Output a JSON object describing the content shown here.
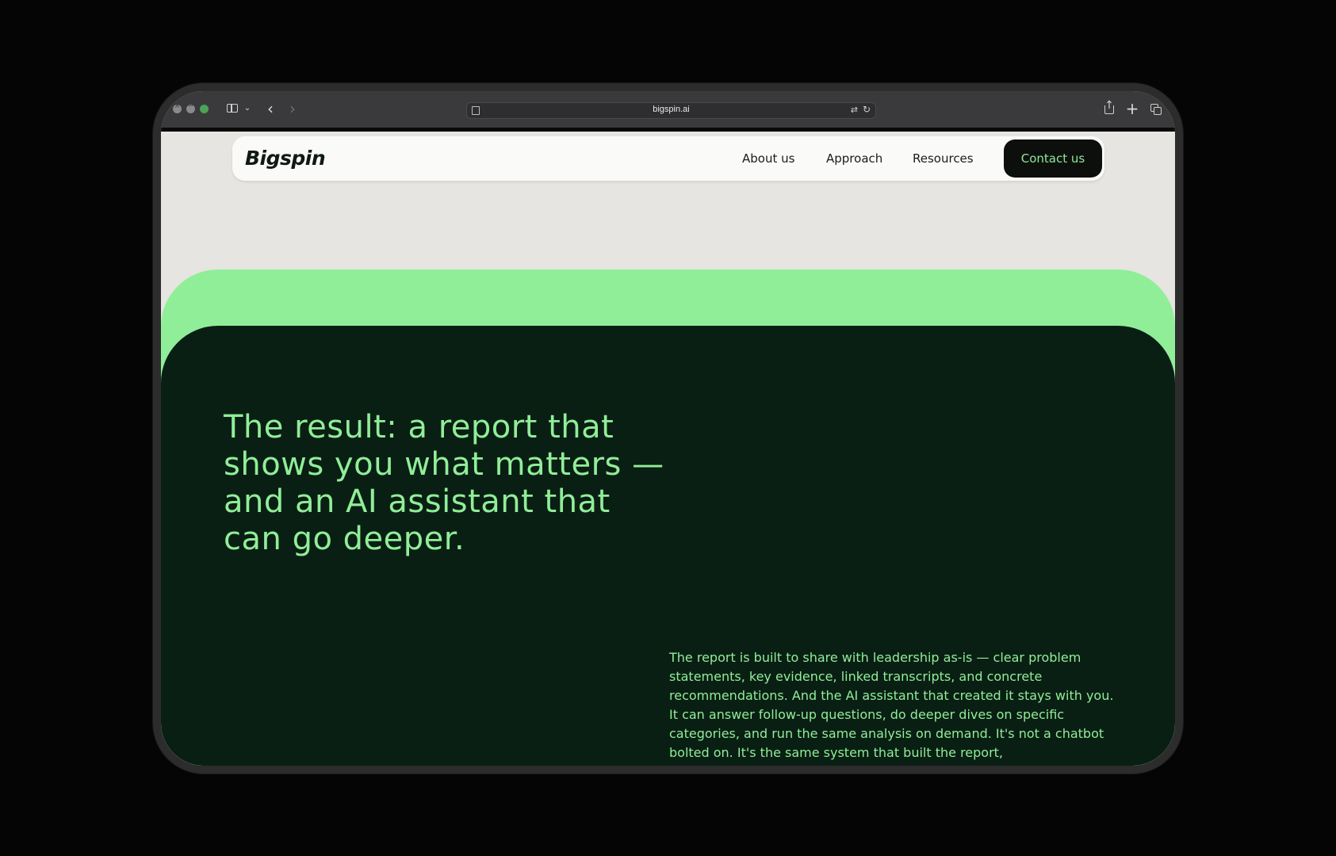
{
  "browser": {
    "url": "bigspin.ai",
    "traffic_lights": [
      "close",
      "minimize",
      "maximize"
    ],
    "icons": [
      "sidebar-icon",
      "chevron-down-icon",
      "back-icon",
      "forward-icon",
      "page-icon",
      "translate-icon",
      "reload-icon",
      "share-icon",
      "plus-icon",
      "tabs-icon"
    ]
  },
  "nav": {
    "logo": "Bigspin",
    "links": [
      "About us",
      "Approach",
      "Resources"
    ],
    "cta": "Contact us"
  },
  "hero": {
    "headline": "The result: a report that shows you what matters — and an AI assistant that can go deeper.",
    "body": "The report is built to share with leadership as-is — clear problem statements, key evidence, linked transcripts, and concrete recommendations. And the AI assistant that created it stays with you. It can answer follow-up questions, do deeper dives on specific categories, and run the same analysis on demand. It's not a chatbot bolted on. It's the same system that built the report,"
  },
  "colors": {
    "accent_green": "#90ee98",
    "dark_panel": "#0a1f14",
    "page_bg": "#e6e5e1",
    "cta_bg": "#0d0f0d"
  }
}
